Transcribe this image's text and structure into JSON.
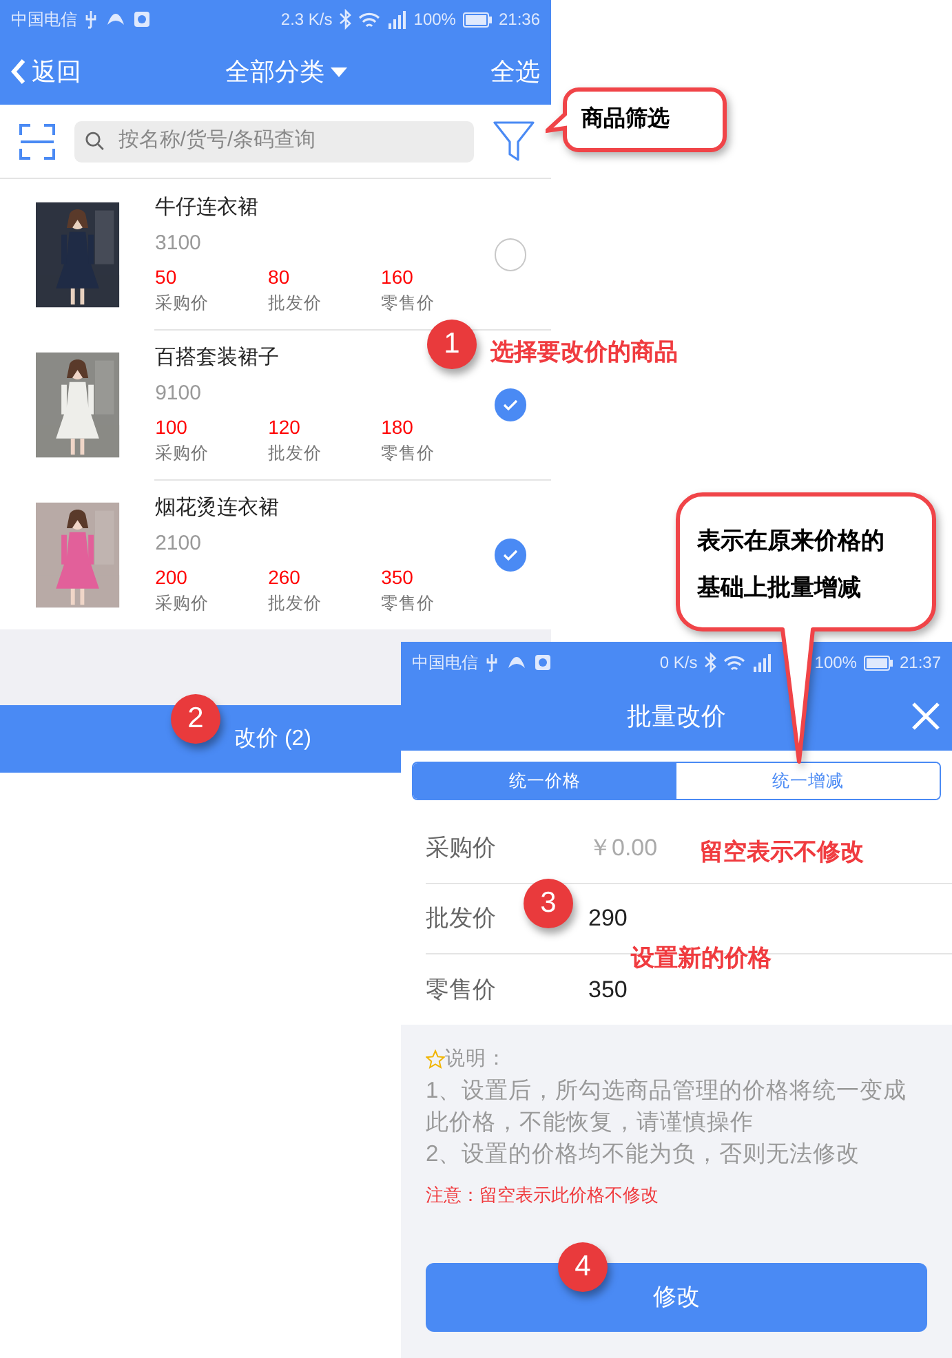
{
  "list_screen": {
    "status_bar": {
      "carrier": "中国电信",
      "speed": "2.3 K/s",
      "battery": "100%",
      "time": "21:36"
    },
    "nav": {
      "back": "返回",
      "title": "全部分类",
      "select_all": "全选"
    },
    "search": {
      "placeholder": "按名称/货号/条码查询"
    },
    "products": [
      {
        "name": "牛仔连衣裙",
        "code": "3100",
        "selected": false,
        "prices": [
          {
            "value": "50",
            "label": "采购价"
          },
          {
            "value": "80",
            "label": "批发价"
          },
          {
            "value": "160",
            "label": "零售价"
          }
        ]
      },
      {
        "name": "百搭套装裙子",
        "code": "9100",
        "selected": true,
        "prices": [
          {
            "value": "100",
            "label": "采购价"
          },
          {
            "value": "120",
            "label": "批发价"
          },
          {
            "value": "180",
            "label": "零售价"
          }
        ]
      },
      {
        "name": "烟花烫连衣裙",
        "code": "2100",
        "selected": true,
        "prices": [
          {
            "value": "200",
            "label": "采购价"
          },
          {
            "value": "260",
            "label": "批发价"
          },
          {
            "value": "350",
            "label": "零售价"
          }
        ]
      }
    ],
    "bottom_button": "改价 (2)"
  },
  "batch_screen": {
    "status_bar": {
      "carrier": "中国电信",
      "speed": "0 K/s",
      "battery": "100%",
      "time": "21:37"
    },
    "title": "批量改价",
    "tabs": [
      {
        "label": "统一价格",
        "selected": true
      },
      {
        "label": "统一增减",
        "selected": false
      }
    ],
    "fields": [
      {
        "label": "采购价",
        "placeholder": "￥0.00"
      },
      {
        "label": "批发价",
        "value": "290"
      },
      {
        "label": "零售价",
        "value": "350"
      }
    ],
    "notes": {
      "heading": "说明：",
      "lines": [
        "1、设置后，所勾选商品管理的价格将统一变成此价格，不能恢复，请谨慎操作",
        "2、设置的价格均不能为负，否则无法修改"
      ],
      "warning": "注意：留空表示此价格不修改"
    },
    "submit": "修改"
  },
  "annotations": [
    {
      "kind": "callout",
      "text": "商品筛选"
    },
    {
      "kind": "step",
      "text": "1"
    },
    {
      "kind": "note",
      "text": "选择要改价的商品"
    },
    {
      "kind": "step",
      "text": "2"
    },
    {
      "kind": "callout",
      "text": "表示在原来价格的基础上批量增减"
    },
    {
      "kind": "note",
      "text": "留空表示不修改"
    },
    {
      "kind": "step",
      "text": "3"
    },
    {
      "kind": "note",
      "text": "设置新的价格"
    },
    {
      "kind": "step",
      "text": "4"
    }
  ]
}
